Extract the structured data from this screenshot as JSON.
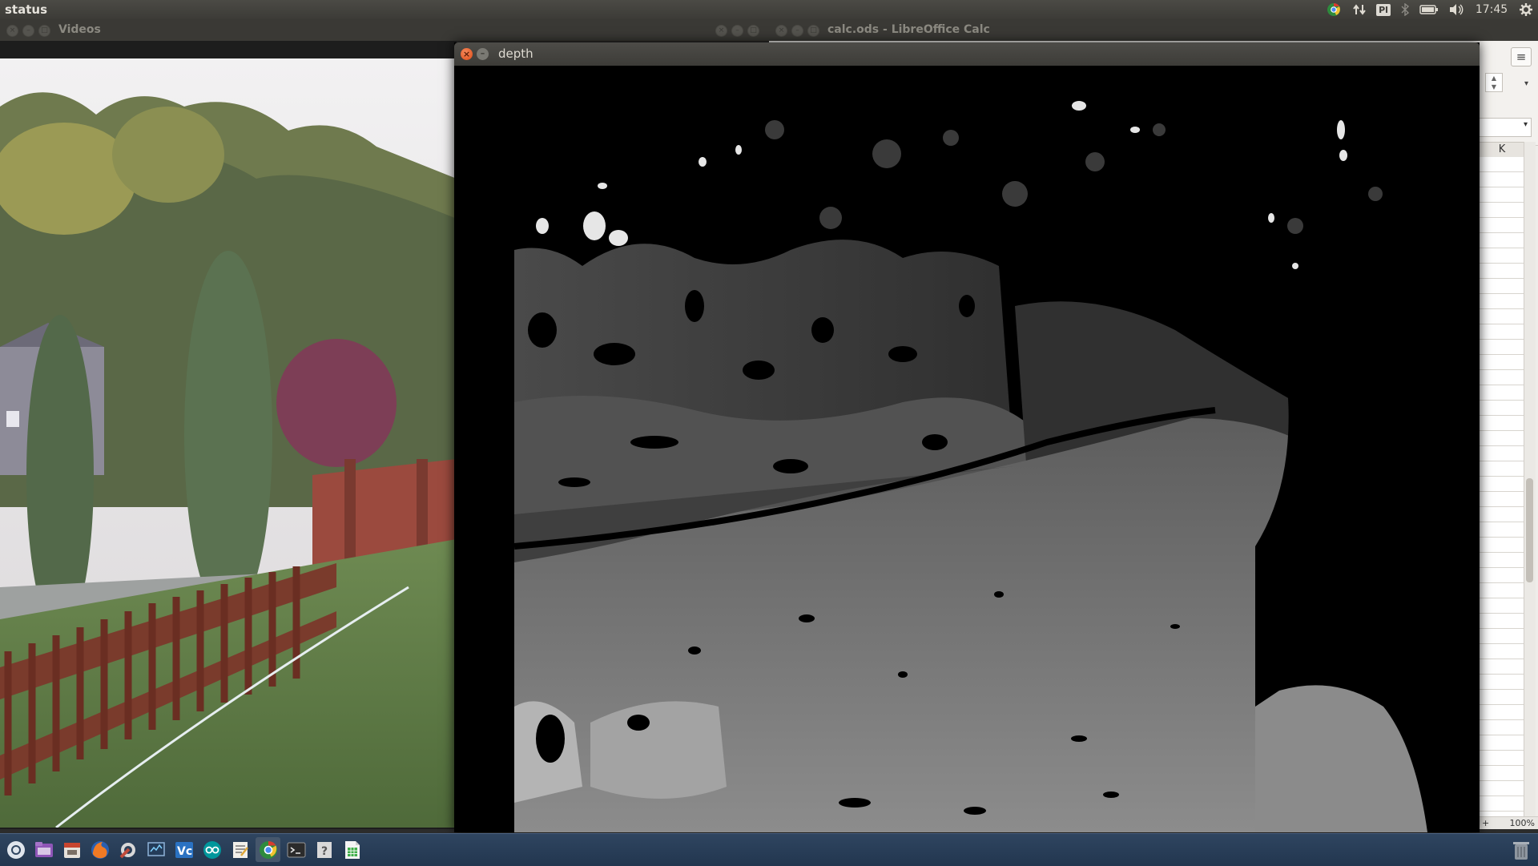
{
  "top_panel": {
    "app_title": "status",
    "keyboard_layout": "Pl",
    "clock": "17:45"
  },
  "windows": {
    "videos": {
      "title": "Videos"
    },
    "calc": {
      "title": "calc.ods - LibreOffice Calc",
      "column_header": "K",
      "zoom": "100%",
      "status_plus": "+"
    },
    "depth": {
      "title": "depth"
    }
  },
  "launcher": {
    "items": [
      "dash",
      "files",
      "calendar",
      "firefox",
      "settings",
      "system-monitor",
      "visual-code",
      "arduino",
      "text-editor",
      "chrome",
      "terminal",
      "help",
      "libreoffice-calc"
    ]
  },
  "colors": {
    "panel": "#3c3b37",
    "close_button": "#df4a16",
    "launcher": "#22364f",
    "calc_background": "#efedea"
  }
}
